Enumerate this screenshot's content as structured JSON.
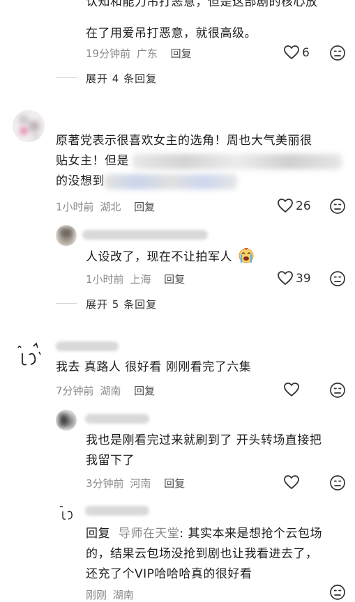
{
  "comment1": {
    "line1_partial": "认知和能力吊打恶意，但是这部剧的核心放",
    "line2": "在了用爱吊打恶意，就很高级。",
    "time": "19分钟前",
    "location": "广东",
    "reply_label": "回复",
    "likes": "6",
    "expand_label": "展开 4 条回复"
  },
  "comment2": {
    "line1": "原著党表示很喜欢女主的选角！周也大气美丽很",
    "line2": "贴女主！但是",
    "line3": "的没想到",
    "time": "1小时前",
    "location": "湖北",
    "reply_label": "回复",
    "likes": "26"
  },
  "reply2_1": {
    "text": "人设改了，现在不让拍军人",
    "time": "1小时前",
    "location": "上海",
    "reply_label": "回复",
    "likes": "39"
  },
  "expand2": {
    "label": "展开 5 条回复"
  },
  "comment3": {
    "text": "我去 真路人 很好看 刚刚看完了六集",
    "time": "7分钟前",
    "location": "湖南",
    "reply_label": "回复"
  },
  "reply3_1": {
    "line1": "我也是刚看完过来就刷到了 开头转场直接把",
    "line2": "我留下了",
    "time": "3分钟前",
    "location": "河南",
    "reply_label": "回复"
  },
  "reply3_2": {
    "prefix": "回复",
    "target": "导师在天堂",
    "line1_rest": ": 其实本来是想抢个云包场",
    "line2": "的，结果云包场没抢到剧也让我看进去了，",
    "line3": "还充了个VIP哈哈哈真的很好看",
    "time": "刚刚",
    "location": "湖南"
  },
  "colors": {
    "meta": "#8a8a8a",
    "text": "#1c1c1c",
    "icon": "#333333"
  },
  "icons": [
    "heart-icon",
    "dislike-face-icon",
    "crying-emoji-icon"
  ]
}
